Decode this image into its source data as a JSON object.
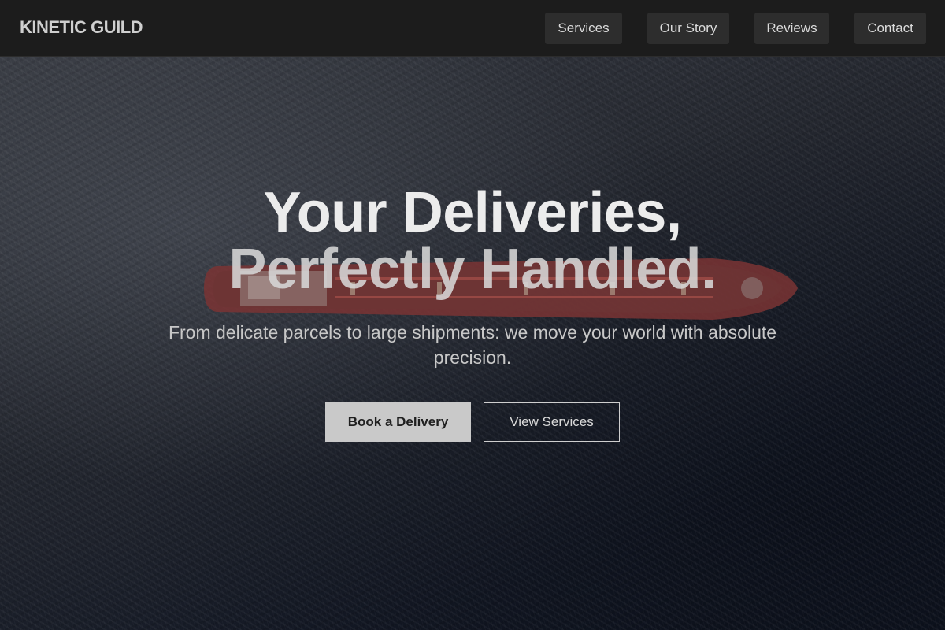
{
  "header": {
    "logo": "KINETIC GUILD",
    "nav": [
      {
        "label": "Services"
      },
      {
        "label": "Our Story"
      },
      {
        "label": "Reviews"
      },
      {
        "label": "Contact"
      }
    ]
  },
  "hero": {
    "title_line1": "Your Deliveries,",
    "title_line2": "Perfectly Handled.",
    "subtitle": "From delicate parcels to large shipments: we move your world with absolute precision.",
    "primary_button": "Book a Delivery",
    "secondary_button": "View Services",
    "background_image": "aerial-cargo-ship-ocean"
  },
  "colors": {
    "nav_background": "#1c1c1c",
    "nav_button": "#2d2d2d",
    "primary_button": "#c9c9c9",
    "ship_hull": "#8a3b3b"
  }
}
